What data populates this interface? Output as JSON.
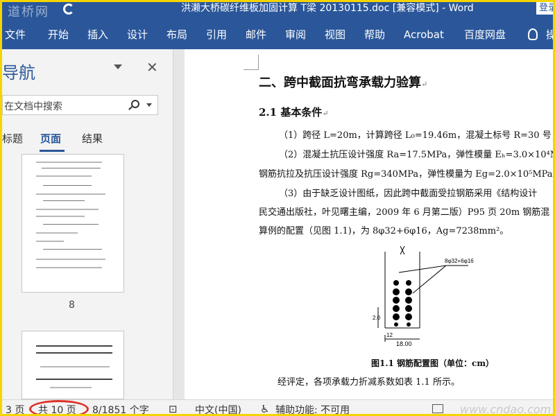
{
  "window": {
    "watermark_logo": "道桥网",
    "title": "洪濑大桥碳纤维板加固计算 T梁 20130115.doc [兼容模式] - Word",
    "login_label": "登录"
  },
  "ribbon": {
    "tabs": [
      "文件",
      "开始",
      "插入",
      "设计",
      "布局",
      "引用",
      "邮件",
      "审阅",
      "视图",
      "帮助",
      "Acrobat",
      "百度网盘"
    ],
    "tell_me_label": "操"
  },
  "nav_pane": {
    "title": "导航",
    "search_placeholder": "在文档中搜索",
    "tabs": [
      "标题",
      "页面",
      "结果"
    ],
    "active_tab": "页面",
    "thumb_page_label": "8"
  },
  "document": {
    "heading1": "二、跨中截面抗弯承载力验算",
    "heading2": "2.1  基本条件",
    "paragraphs": [
      "（1）跨径 L=20m，计算跨径 L₀=19.46m，混凝土标号 R=30 号；",
      "（2）混凝土抗压设计强度 Ra=17.5MPa，弹性模量 Eₕ=3.0×10⁴M",
      "钢筋抗拉及抗压设计强度 Rg=340MPa，弹性模量为 Eg=2.0×10⁵MPa",
      "（3）由于缺乏设计图纸，因此跨中截面受拉钢筋采用《结构设计",
      "民交通出版社，叶见曙主编，2009 年 6 月第二版）P95 页 20m 钢筋混",
      "算例的配置（见图 1.1)，为 8φ32+6φ16，Ag=7238mm²。"
    ],
    "figure_label_rebar": "8φ32+6φ16",
    "figure_label_dim1": "18.00",
    "figure_label_dim2": "12",
    "figure_label_vertical": "2.0",
    "figure_caption": "图1.1    钢筋配置图（单位：cm）",
    "after_figure": "经评定，各项承载力折减系数如表 1.1 所示。"
  },
  "status_bar": {
    "page_of": "3 页",
    "total_pages": "共 10 页",
    "word_count": "8/1851 个字",
    "language": "中文(中国)",
    "accessibility": "辅助功能: 不可用",
    "watermark": "www.cndao.com"
  }
}
